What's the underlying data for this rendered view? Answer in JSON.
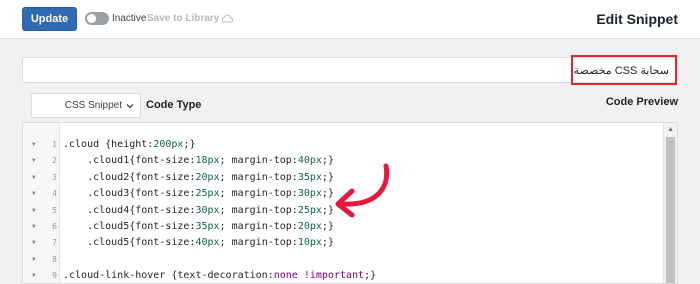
{
  "toolbar": {
    "update_label": "Update",
    "status_label": "Inactive",
    "save_library_label": "Save to Library",
    "page_title": "Edit Snippet"
  },
  "snippet": {
    "title_value": "سحابة CSS مخصصة",
    "type_value": "CSS Snippet",
    "type_label": "Code Type",
    "preview_label": "Code Preview"
  },
  "colors": {
    "accent": "#2f6ab3",
    "highlight": "#e3262c",
    "arrow": "#e8173b"
  },
  "code_lines": [
    {
      "n": "1",
      "html": ".cloud {height:<span class='num-val'>200px</span>;}"
    },
    {
      "n": "2",
      "html": "    .cloud1{font-size:<span class='num-val'>18px</span>; margin-top:<span class='num-val'>40px</span>;}"
    },
    {
      "n": "3",
      "html": "    .cloud2{font-size:<span class='num-val'>20px</span>; margin-top:<span class='num-val'>35px</span>;}"
    },
    {
      "n": "4",
      "html": "    .cloud3{font-size:<span class='num-val'>25px</span>; margin-top:<span class='num-val'>30px</span>;}"
    },
    {
      "n": "5",
      "html": "    .cloud4{font-size:<span class='num-val'>30px</span>; margin-top:<span class='num-val'>25px</span>;}"
    },
    {
      "n": "6",
      "html": "    .cloud5{font-size:<span class='num-val'>35px</span>; margin-top:<span class='num-val'>20px</span>;}"
    },
    {
      "n": "7",
      "html": "    .cloud5{font-size:<span class='num-val'>40px</span>; margin-top:<span class='num-val'>10px</span>;}"
    },
    {
      "n": "8",
      "html": ""
    },
    {
      "n": "9",
      "html": ".cloud-link-hover {text-decoration:<span class='kw'>none</span> <span class='imp'>!important</span>;}"
    }
  ]
}
